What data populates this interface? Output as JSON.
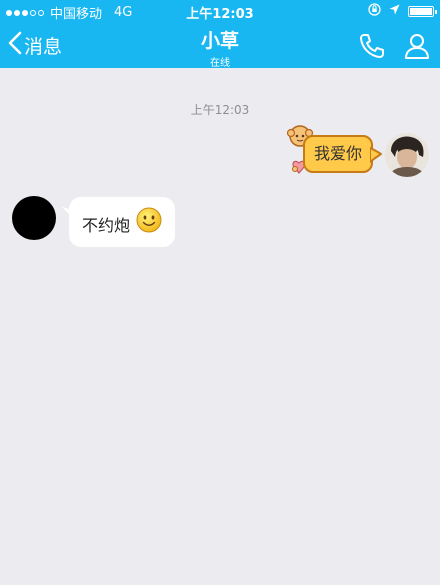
{
  "status_bar": {
    "carrier": "中国移动",
    "network": "4G",
    "time": "上午12:03"
  },
  "nav": {
    "back_label": "消息",
    "title": "小草",
    "subtitle": "在线",
    "icons": [
      "chevron-left-icon",
      "phone-icon",
      "user-icon"
    ]
  },
  "chat": {
    "timestamp": "上午12:03",
    "messages": [
      {
        "direction": "outgoing",
        "text": "我爱你"
      },
      {
        "direction": "incoming",
        "text": "不约炮",
        "emoji": "smiley-icon"
      }
    ]
  },
  "colors": {
    "header": "#19b7f2",
    "background": "#ebebf0",
    "outgoing_bubble": "#ffc94a",
    "incoming_bubble": "#ffffff"
  }
}
